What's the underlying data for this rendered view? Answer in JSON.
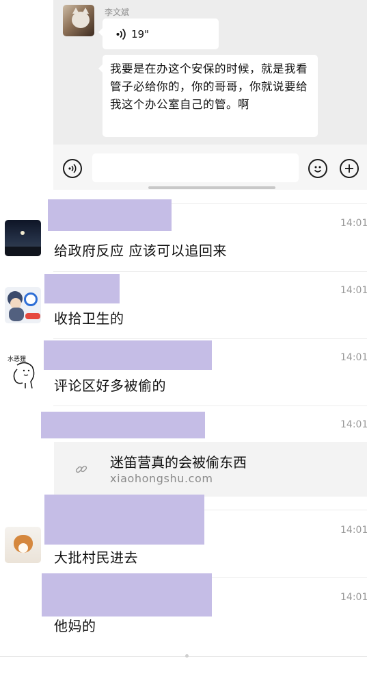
{
  "quoted_chat": {
    "sender": "李文斌",
    "voice_duration": "19\"",
    "voice_icon": "voice-wave-icon",
    "text_message": "我要是在办这个安保的时候，就是我看管子必给你的，你的哥哥，你就说要给我这个办公室自己的管。啊",
    "input": {
      "placeholder": "",
      "voice_button": "voice-toggle-icon",
      "emoji_button": "emoji-icon",
      "more_button": "plus-icon"
    }
  },
  "messages": [
    {
      "time": "14:01",
      "text": "给政府反应 应该可以追回来",
      "avatar": "moon-night-avatar"
    },
    {
      "time": "14:01",
      "text": "收拾卫生的",
      "avatar": "cartoon-avatar"
    },
    {
      "time": "14:01",
      "text": "评论区好多被偷的",
      "avatar": "sketch-avatar"
    },
    {
      "time": "14:01",
      "link": {
        "title": "迷笛营真的会被偷东西",
        "domain": "xiaohongshu.com",
        "icon": "link-icon"
      }
    },
    {
      "time": "14:01",
      "text": "大批村民进去",
      "avatar": "dog-avatar"
    },
    {
      "time": "14:01",
      "text": "他妈的"
    }
  ],
  "colors": {
    "redaction": "#c5bde6",
    "panel_bg": "#ededed",
    "bubble_bg": "#ffffff",
    "time_text": "#9a9a9a"
  },
  "avatar_badge": "水恶狸"
}
